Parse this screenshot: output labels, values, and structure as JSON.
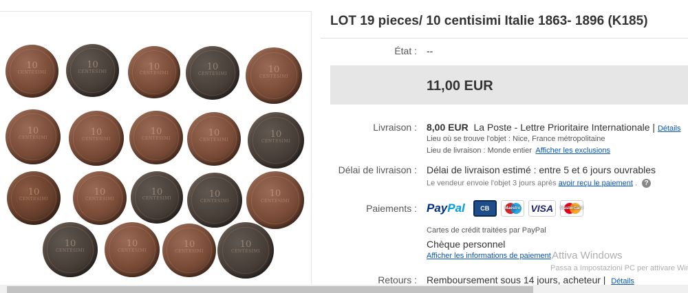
{
  "listing": {
    "title": "LOT 19 pieces/ 10 centisimi Italie 1863- 1896 (K185)",
    "condition_label": "État :",
    "condition_value": "--",
    "price": "11,00 EUR"
  },
  "shipping": {
    "label": "Livraison :",
    "cost": "8,00 EUR",
    "service": "La Poste - Lettre Prioritaire Internationale",
    "separator": "|",
    "details_link": "Détails",
    "location_label": "Lieu où se trouve l'objet :",
    "location_value": "Nice, France métropolitaine",
    "ships_to_label": "Lieu de livraison :",
    "ships_to_value": "Monde entier",
    "exclusions_link": "Afficher les exclusions"
  },
  "delivery": {
    "label": "Délai de livraison :",
    "estimate": "Délai de livraison estimé : entre 5 et 6 jours ouvrables",
    "note": "Le vendeur envoie l'objet 3 jours après",
    "note_link": "avoir reçu le paiement",
    "note_end": ".",
    "help_icon_text": "?"
  },
  "payments": {
    "label": "Paiements :",
    "paypal_text_a": "Pay",
    "paypal_text_b": "Pal",
    "cb_text": "CB",
    "maestro_text": "Maestro",
    "visa_text": "VISA",
    "mastercard_text": "MasterCard",
    "card_note": "Cartes de crédit traitées par PayPal",
    "cheque": "Chèque personnel",
    "info_link": "Afficher les informations de paiement"
  },
  "returns": {
    "label": "Retours :",
    "value": "Remboursement sous 14 jours, acheteur |",
    "details_link": "Détails"
  },
  "overlay": {
    "watermark_line1": "Attiva Windows",
    "watermark_line2": "Passa a Impostazioni PC per attivare Windows."
  },
  "coins": {
    "count": 19,
    "denomination": "10",
    "legend": "CENTESIMI"
  }
}
